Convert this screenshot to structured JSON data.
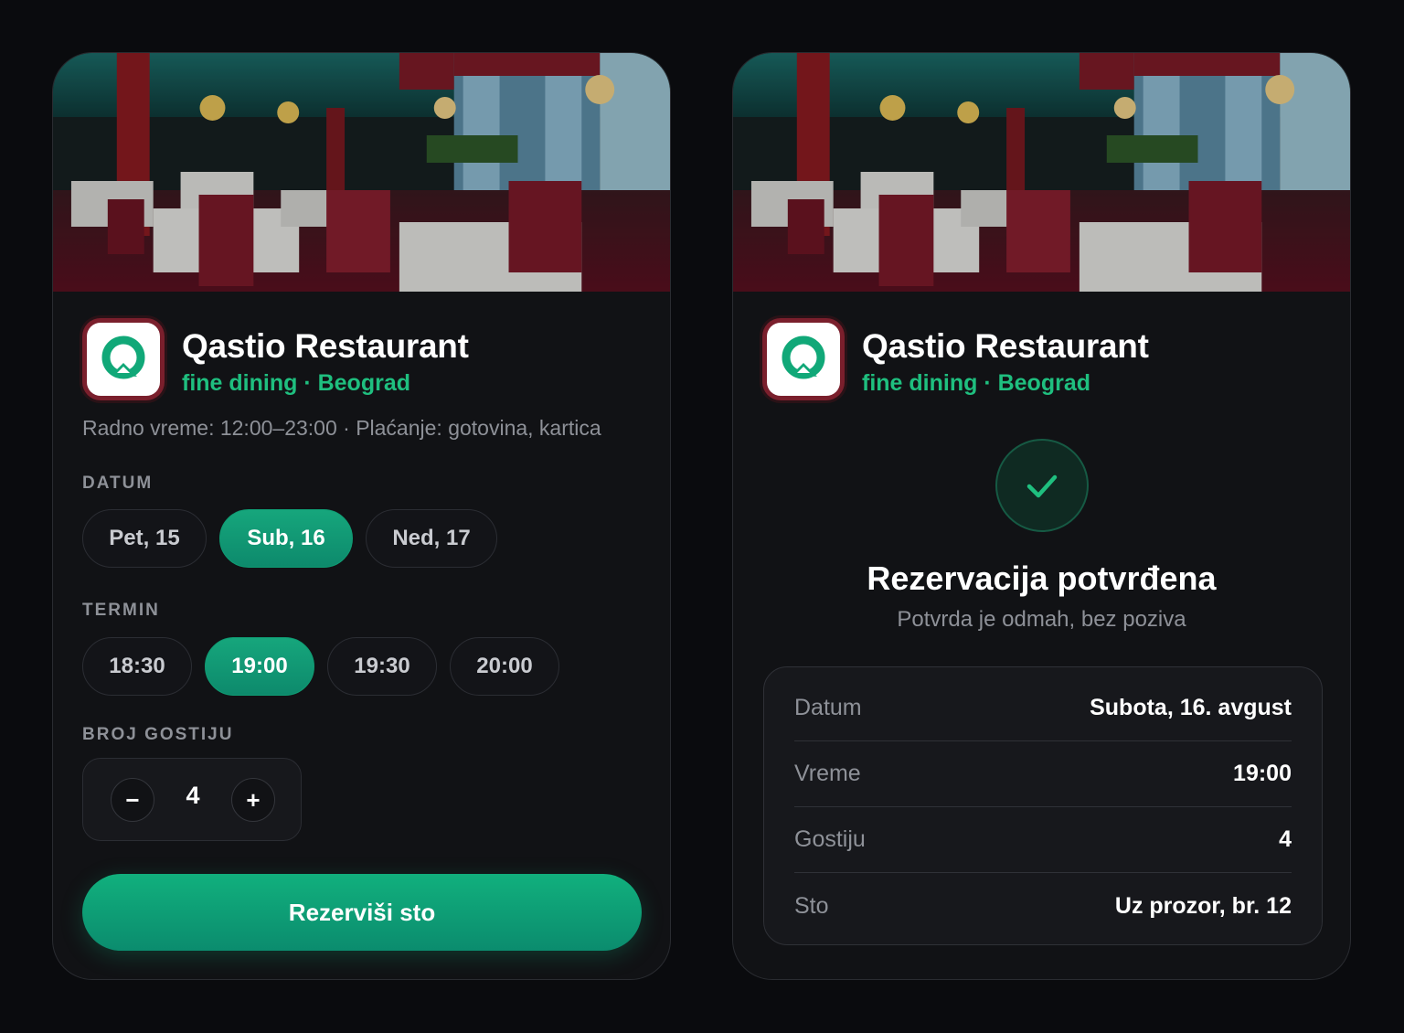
{
  "restaurant": {
    "name": "Qastio Restaurant",
    "subtitle": "fine dining · Beograd",
    "info": "Radno vreme: 12:00–23:00 · Plaćanje: gotovina, kartica"
  },
  "booking": {
    "date_label": "DATUM",
    "dates": [
      "Pet, 15",
      "Sub, 16",
      "Ned, 17"
    ],
    "selected_date": "Sub, 16",
    "time_label": "TERMIN",
    "times": [
      "18:30",
      "19:00",
      "19:30",
      "20:00"
    ],
    "selected_time": "19:00",
    "guests_label": "BROJ GOSTIJU",
    "guests": "4",
    "minus": "−",
    "plus": "+",
    "cta": "Rezerviši sto"
  },
  "confirmation": {
    "title": "Rezervacija potvrđena",
    "subtitle": "Potvrda je odmah, bez poziva",
    "rows": [
      {
        "key": "Datum",
        "value": "Subota, 16. avgust"
      },
      {
        "key": "Vreme",
        "value": "19:00"
      },
      {
        "key": "Gostiju",
        "value": "4"
      },
      {
        "key": "Sto",
        "value": "Uz prozor, br. 12"
      }
    ]
  },
  "colors": {
    "accent": "#0f9c73",
    "accent_text": "#1fbf7f",
    "background": "#0a0b0e",
    "card": "#111215",
    "logo_border": "#7a1f2c"
  },
  "icons": {
    "logo": "q-logo-icon",
    "check": "check-icon"
  }
}
